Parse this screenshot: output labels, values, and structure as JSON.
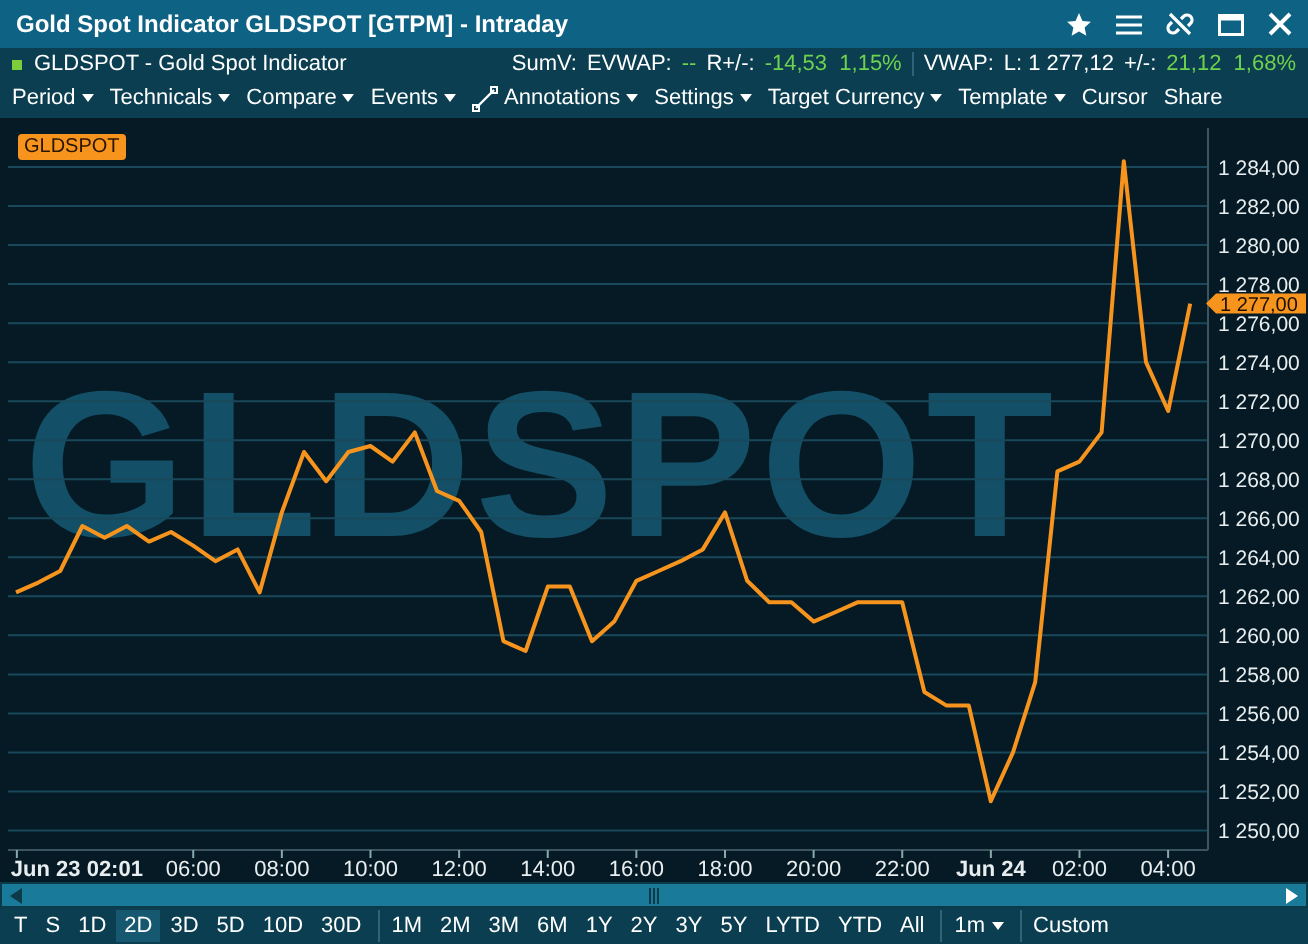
{
  "window": {
    "title": "Gold Spot Indicator GLDSPOT [GTPM] - Intraday"
  },
  "instrument": {
    "label": "GLDSPOT - Gold Spot Indicator",
    "color": "#7ccf3a"
  },
  "stats": [
    {
      "label": "SumV:",
      "separator_before": false
    },
    {
      "label": "EVWAP:",
      "value": "--",
      "separator_before": false
    },
    {
      "label": "R+/-:",
      "value": "-14,53  1,15%",
      "separator_before": false
    },
    {
      "label": "VWAP:",
      "separator_before": true
    },
    {
      "label": "L: 1 277,12",
      "separator_before": false
    },
    {
      "label": "+/-:",
      "value": "21,12  1,68%",
      "separator_before": false
    }
  ],
  "menu": [
    {
      "label": "Period",
      "kind": "dropdown"
    },
    {
      "label": "Technicals",
      "kind": "dropdown"
    },
    {
      "label": "Compare",
      "kind": "dropdown"
    },
    {
      "label": "Events",
      "kind": "dropdown"
    },
    {
      "label": "Annotations",
      "kind": "annotations"
    },
    {
      "label": "Settings",
      "kind": "dropdown"
    },
    {
      "label": "Target Currency",
      "kind": "dropdown"
    },
    {
      "label": "Template",
      "kind": "dropdown"
    },
    {
      "label": "Cursor",
      "kind": "plain"
    },
    {
      "label": "Share",
      "kind": "plain"
    }
  ],
  "chart": {
    "watermark": "GLDSPOT",
    "last_price": "1 277,00",
    "next_day_labels": [
      {
        "label": "Jun 24"
      },
      {
        "label": "02:00"
      },
      {
        "label": "04:00"
      }
    ],
    "chart_data": {
      "type": "line",
      "grid": true,
      "xlim": [
        1.82,
        28.9
      ],
      "ylim": [
        1249,
        1286
      ],
      "x": [
        2,
        2.5,
        3,
        3.5,
        4,
        4.5,
        5,
        5.5,
        6,
        6.5,
        7,
        7.5,
        8,
        8.5,
        9,
        9.5,
        10,
        10.5,
        11,
        11.5,
        12,
        12.5,
        13,
        13.5,
        14,
        14.5,
        15,
        15.5,
        16,
        16.5,
        17,
        17.5,
        18,
        18.5,
        19,
        19.5,
        20,
        20.5,
        21,
        21.5,
        22,
        22.5,
        23,
        23.5,
        24,
        24.5,
        25,
        25.5,
        26,
        26.5,
        27,
        27.5,
        28,
        28.5
      ],
      "xticks": [
        {
          "value": 2.02,
          "label": "Jun 23 02:01"
        },
        {
          "value": 6,
          "label": "06:00"
        },
        {
          "value": 8,
          "label": "08:00"
        },
        {
          "value": 10,
          "label": "10:00"
        },
        {
          "value": 12,
          "label": "12:00"
        },
        {
          "value": 14,
          "label": "14:00"
        },
        {
          "value": 16,
          "label": "16:00"
        },
        {
          "value": 18,
          "label": "18:00"
        },
        {
          "value": 20,
          "label": "20:00"
        },
        {
          "value": 22,
          "label": "22:00"
        }
      ],
      "series": [
        {
          "name": "GLDSPOT",
          "color": "#f7941d",
          "values": [
            1262.2,
            1262.7,
            1263.3,
            1265.6,
            1265,
            1265.6,
            1264.8,
            1265.3,
            1264.6,
            1263.8,
            1264.4,
            1262.2,
            1266.3,
            1269.4,
            1267.9,
            1269.4,
            1269.7,
            1268.9,
            1270.4,
            1267.4,
            1266.9,
            1265.3,
            1259.7,
            1259.2,
            1262.5,
            1262.5,
            1259.7,
            1260.7,
            1262.8,
            1263.3,
            1263.8,
            1264.4,
            1266.3,
            1262.8,
            1261.7,
            1261.7,
            1260.7,
            1261.2,
            1261.7,
            1261.7,
            1261.7,
            1257.1,
            1256.4,
            1256.4,
            1251.5,
            1254,
            1257.6,
            1268.4,
            1268.9,
            1270.4,
            1284.3,
            1274,
            1271.5,
            1277
          ]
        }
      ],
      "yticks": [
        {
          "value": 1250,
          "label": "1 250,00"
        },
        {
          "value": 1252,
          "label": "1 252,00"
        },
        {
          "value": 1254,
          "label": "1 254,00"
        },
        {
          "value": 1256,
          "label": "1 256,00"
        },
        {
          "value": 1258,
          "label": "1 258,00"
        },
        {
          "value": 1260,
          "label": "1 260,00"
        },
        {
          "value": 1262,
          "label": "1 262,00"
        },
        {
          "value": 1264,
          "label": "1 264,00"
        },
        {
          "value": 1266,
          "label": "1 266,00"
        },
        {
          "value": 1268,
          "label": "1 268,00"
        },
        {
          "value": 1270,
          "label": "1 270,00"
        },
        {
          "value": 1272,
          "label": "1 272,00"
        },
        {
          "value": 1274,
          "label": "1 274,00"
        },
        {
          "value": 1276,
          "label": "1 276,00"
        },
        {
          "value": 1278,
          "label": "1 278,00"
        },
        {
          "value": 1280,
          "label": "1 280,00"
        },
        {
          "value": 1282,
          "label": "1 282,00"
        },
        {
          "value": 1284,
          "label": "1 284,00"
        }
      ]
    }
  },
  "ranges": [
    {
      "label": "T",
      "selected": false,
      "kind": "plain",
      "separator_before": false
    },
    {
      "label": "S",
      "selected": false,
      "kind": "plain",
      "separator_before": false
    },
    {
      "label": "1D",
      "selected": false,
      "kind": "plain",
      "separator_before": false
    },
    {
      "label": "2D",
      "selected": true,
      "kind": "plain",
      "separator_before": false
    },
    {
      "label": "3D",
      "selected": false,
      "kind": "plain",
      "separator_before": false
    },
    {
      "label": "5D",
      "selected": false,
      "kind": "plain",
      "separator_before": false
    },
    {
      "label": "10D",
      "selected": false,
      "kind": "plain",
      "separator_before": false
    },
    {
      "label": "30D",
      "selected": false,
      "kind": "plain",
      "separator_before": false
    },
    {
      "label": "1M",
      "selected": false,
      "kind": "plain",
      "separator_before": true
    },
    {
      "label": "2M",
      "selected": false,
      "kind": "plain",
      "separator_before": false
    },
    {
      "label": "3M",
      "selected": false,
      "kind": "plain",
      "separator_before": false
    },
    {
      "label": "6M",
      "selected": false,
      "kind": "plain",
      "separator_before": false
    },
    {
      "label": "1Y",
      "selected": false,
      "kind": "plain",
      "separator_before": false
    },
    {
      "label": "2Y",
      "selected": false,
      "kind": "plain",
      "separator_before": false
    },
    {
      "label": "3Y",
      "selected": false,
      "kind": "plain",
      "separator_before": false
    },
    {
      "label": "5Y",
      "selected": false,
      "kind": "plain",
      "separator_before": false
    },
    {
      "label": "LYTD",
      "selected": false,
      "kind": "plain",
      "separator_before": false
    },
    {
      "label": "YTD",
      "selected": false,
      "kind": "plain",
      "separator_before": false
    },
    {
      "label": "All",
      "selected": false,
      "kind": "plain",
      "separator_before": false
    },
    {
      "label": "1m",
      "selected": false,
      "kind": "dropdown",
      "separator_before": true
    },
    {
      "label": "Custom",
      "selected": false,
      "kind": "plain",
      "separator_before": true
    }
  ]
}
